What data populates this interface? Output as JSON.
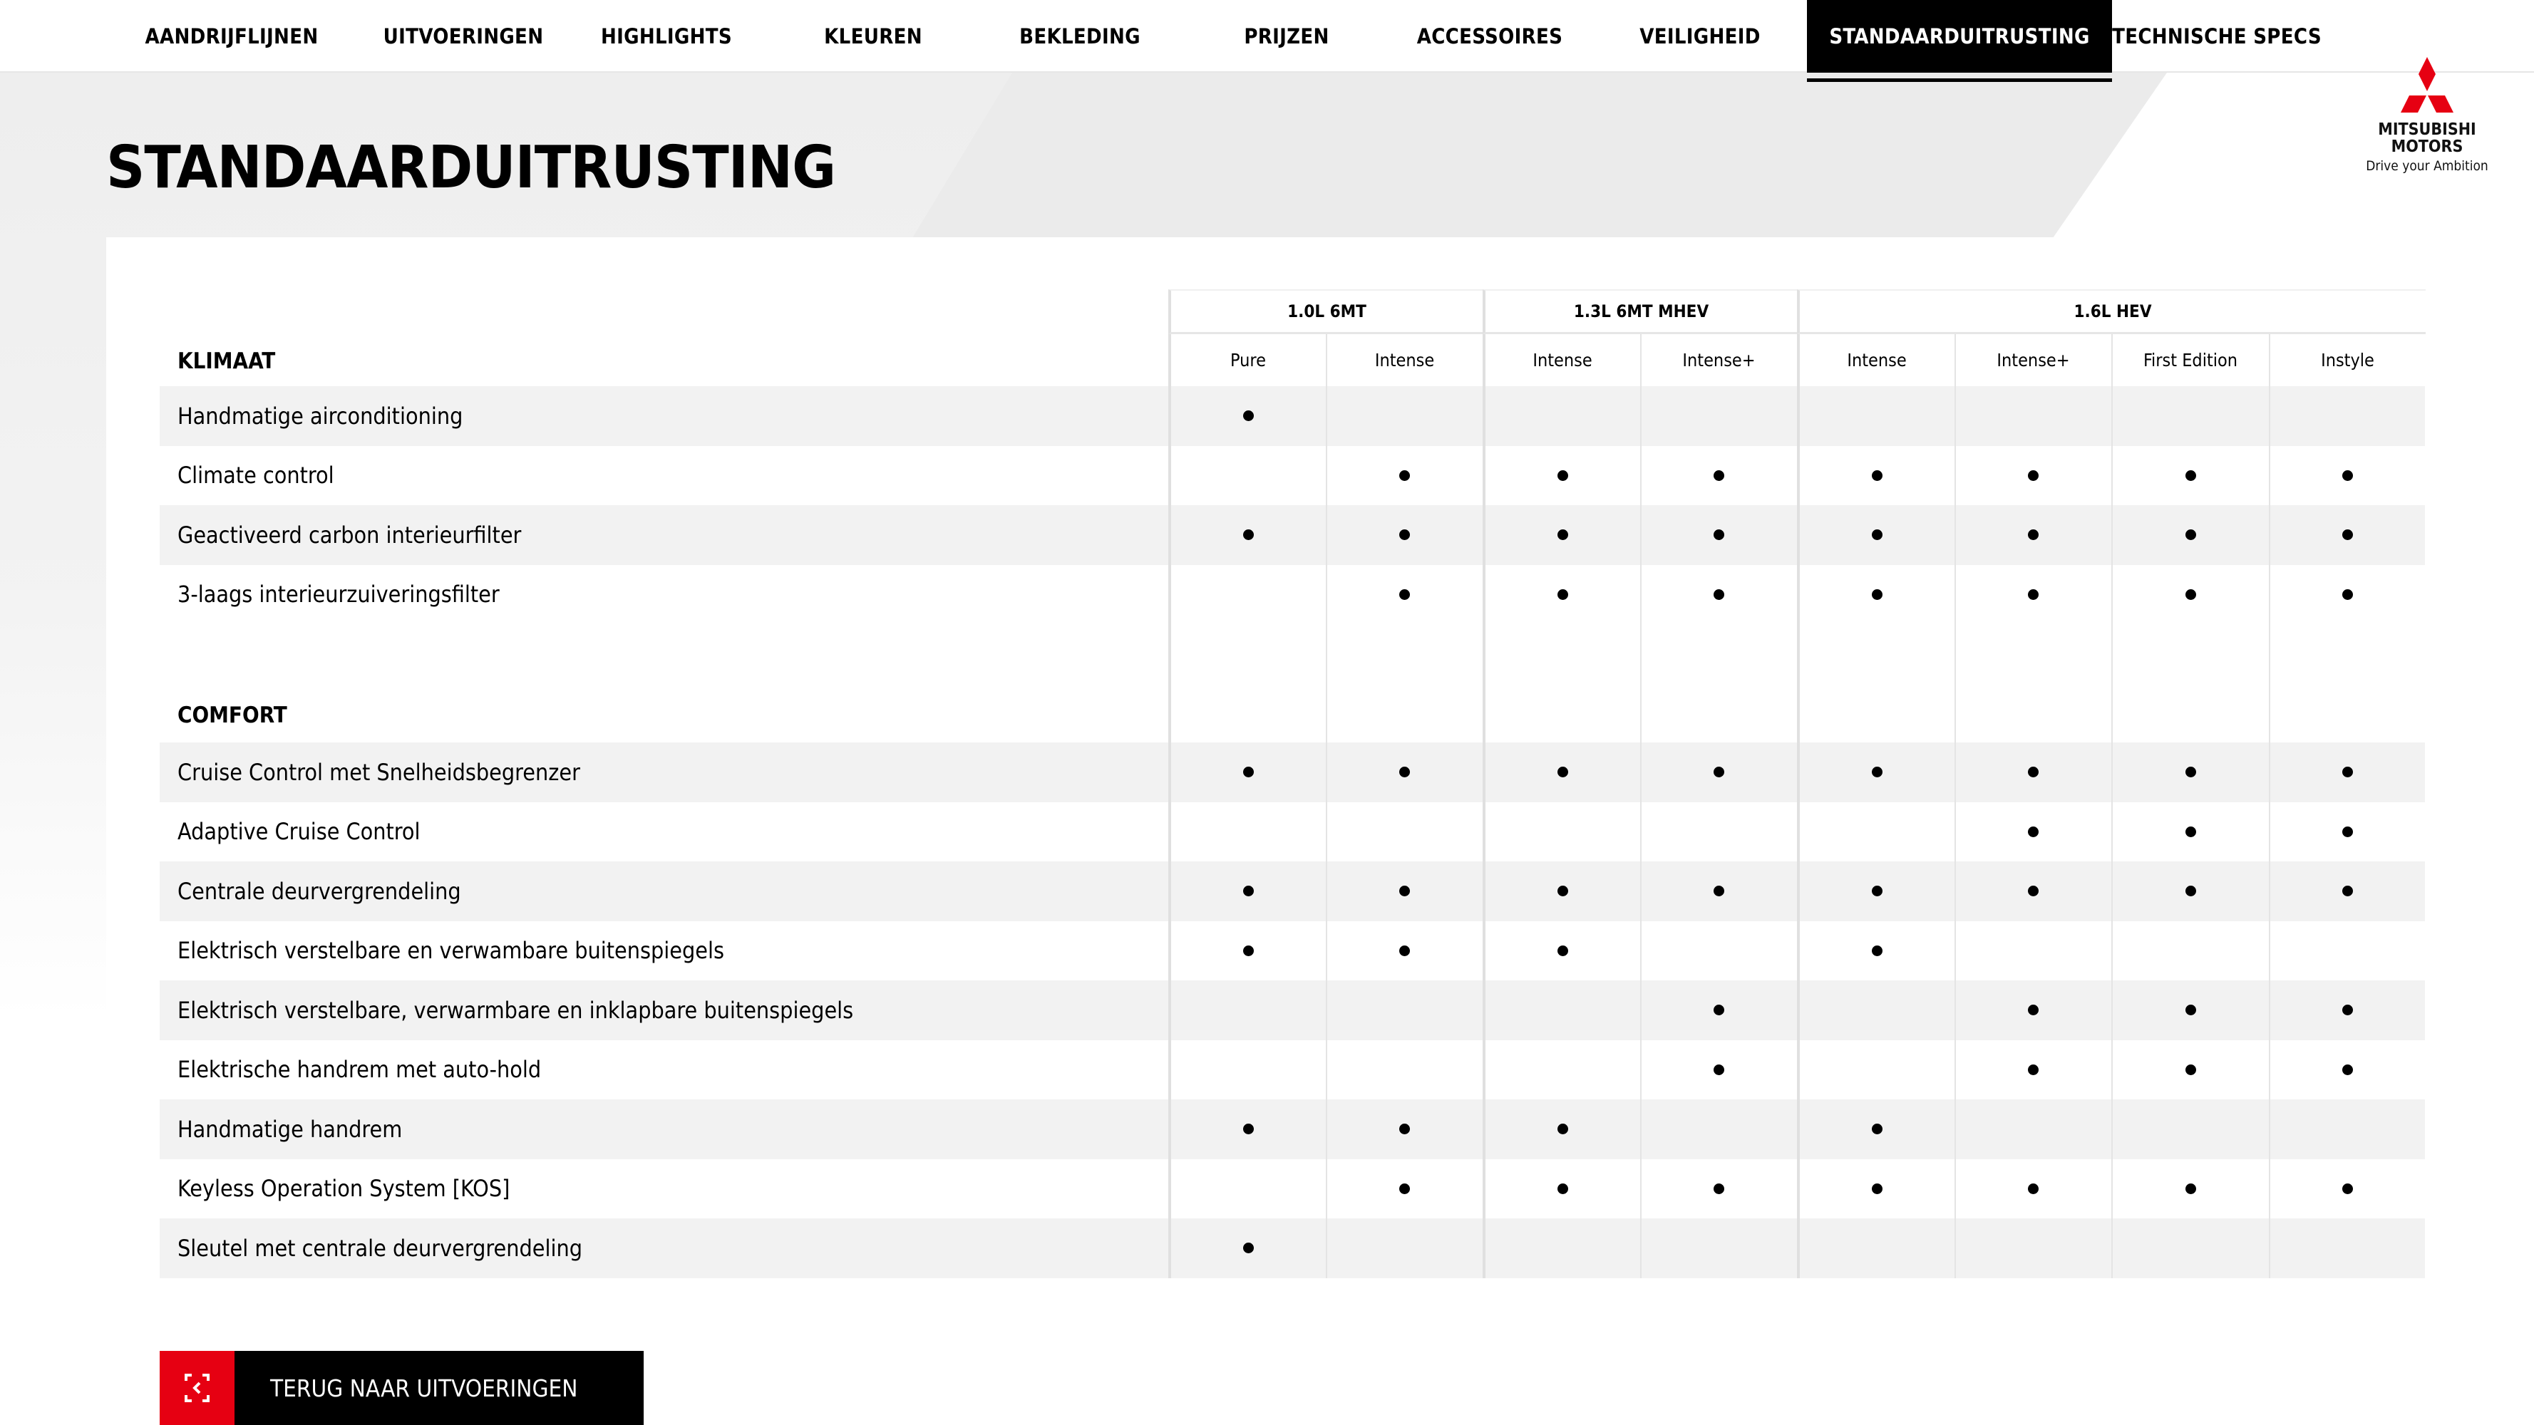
{
  "nav": {
    "items": [
      {
        "label": "AANDRIJFLIJNEN",
        "active": false
      },
      {
        "label": "UITVOERINGEN",
        "active": false
      },
      {
        "label": "HIGHLIGHTS",
        "active": false
      },
      {
        "label": "KLEUREN",
        "active": false
      },
      {
        "label": "BEKLEDING",
        "active": false
      },
      {
        "label": "PRIJZEN",
        "active": false
      },
      {
        "label": "ACCESSOIRES",
        "active": false
      },
      {
        "label": "VEILIGHEID",
        "active": false
      },
      {
        "label": "STANDAARDUITRUSTING",
        "active": true
      },
      {
        "label": "TECHNISCHE SPECS",
        "active": false
      }
    ]
  },
  "logo": {
    "brand_line1": "MITSUBISHI",
    "brand_line2": "MOTORS",
    "tagline": "Drive your Ambition",
    "color": "#e60012"
  },
  "page_title": "STANDAARDUITRUSTING",
  "table": {
    "groups": [
      {
        "label": "1.0L 6MT",
        "span": 2
      },
      {
        "label": "1.3L 6MT MHEV",
        "span": 2
      },
      {
        "label": "1.6L HEV",
        "span": 4
      }
    ],
    "versions": [
      "Pure",
      "Intense",
      "Intense",
      "Intense+",
      "Intense",
      "Intense+",
      "First Edition",
      "Instyle"
    ],
    "sections": [
      {
        "title": "KLIMAAT",
        "rows": [
          {
            "feature": "Handmatige airconditioning",
            "values": [
              1,
              0,
              0,
              0,
              0,
              0,
              0,
              0
            ]
          },
          {
            "feature": "Climate control",
            "values": [
              0,
              1,
              1,
              1,
              1,
              1,
              1,
              1
            ]
          },
          {
            "feature": "Geactiveerd carbon interieurfilter",
            "values": [
              1,
              1,
              1,
              1,
              1,
              1,
              1,
              1
            ]
          },
          {
            "feature": "3-laags interieurzuiveringsfilter",
            "values": [
              0,
              1,
              1,
              1,
              1,
              1,
              1,
              1
            ]
          }
        ]
      },
      {
        "title": "COMFORT",
        "rows": [
          {
            "feature": "Cruise Control met Snelheidsbegrenzer",
            "values": [
              1,
              1,
              1,
              1,
              1,
              1,
              1,
              1
            ]
          },
          {
            "feature": "Adaptive Cruise Control",
            "values": [
              0,
              0,
              0,
              0,
              0,
              1,
              1,
              1
            ]
          },
          {
            "feature": "Centrale deurvergrendeling",
            "values": [
              1,
              1,
              1,
              1,
              1,
              1,
              1,
              1
            ]
          },
          {
            "feature": "Elektrisch verstelbare en verwambare buitenspiegels",
            "values": [
              1,
              1,
              1,
              0,
              1,
              0,
              0,
              0
            ]
          },
          {
            "feature": "Elektrisch verstelbare, verwarmbare en inklapbare buitenspiegels",
            "values": [
              0,
              0,
              0,
              1,
              0,
              1,
              1,
              1
            ]
          },
          {
            "feature": "Elektrische handrem met auto-hold",
            "values": [
              0,
              0,
              0,
              1,
              0,
              1,
              1,
              1
            ]
          },
          {
            "feature": "Handmatige handrem",
            "values": [
              1,
              1,
              1,
              0,
              1,
              0,
              0,
              0
            ]
          },
          {
            "feature": "Keyless Operation System [KOS]",
            "values": [
              0,
              1,
              1,
              1,
              1,
              1,
              1,
              1
            ]
          },
          {
            "feature": "Sleutel met centrale deurvergrendeling",
            "values": [
              1,
              0,
              0,
              0,
              0,
              0,
              0,
              0
            ]
          }
        ]
      }
    ]
  },
  "back_button": {
    "label": "TERUG NAAR UITVOERINGEN",
    "icon": "back-arrow-icon",
    "accent": "#e60012"
  }
}
